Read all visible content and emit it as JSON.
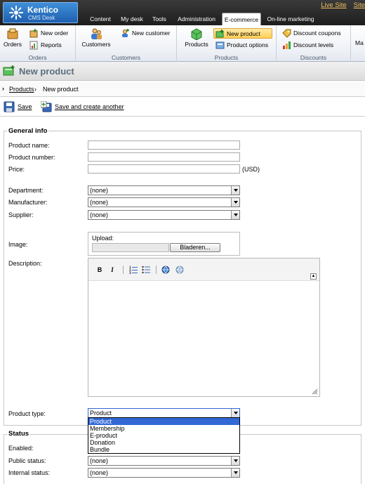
{
  "logo": {
    "brand": "Kentico",
    "sub": "CMS Desk"
  },
  "top_links": [
    "Live Site",
    "Site"
  ],
  "main_tabs": [
    {
      "label": "Content"
    },
    {
      "label": "My desk"
    },
    {
      "label": "Tools"
    },
    {
      "label": "Administration"
    },
    {
      "label": "E-commerce",
      "active": true
    },
    {
      "label": "On-line marketing"
    }
  ],
  "ribbon": {
    "groups": [
      {
        "label": "Orders",
        "items": [
          "Orders",
          "New order",
          "Reports"
        ]
      },
      {
        "label": "Customers",
        "items": [
          "Customers",
          "New customer"
        ]
      },
      {
        "label": "Products",
        "items": [
          "Products",
          "New product",
          "Product options"
        ]
      },
      {
        "label": "Discounts",
        "items": [
          "Discount coupons",
          "Discount levels"
        ]
      },
      {
        "label": "",
        "items": [
          "Ma"
        ]
      }
    ]
  },
  "page": {
    "title": "New product"
  },
  "breadcrumb": {
    "link": "Products",
    "separator": "›",
    "current": "New product"
  },
  "actions": {
    "save": "Save",
    "save_and_create": "Save and create another"
  },
  "general_info": {
    "legend": "General info",
    "product_name_label": "Product name:",
    "product_number_label": "Product number:",
    "price_label": "Price:",
    "currency": "(USD)",
    "department_label": "Department:",
    "department_value": "(none)",
    "manufacturer_label": "Manufacturer:",
    "manufacturer_value": "(none)",
    "supplier_label": "Supplier:",
    "supplier_value": "(none)",
    "image_label": "Image:",
    "upload_label": "Upload:",
    "browse_button": "Bladeren...",
    "description_label": "Description:",
    "editor_buttons": [
      "B",
      "I"
    ],
    "product_type_label": "Product type:",
    "product_type_value": "Product",
    "product_type_options": [
      "Product",
      "Membership",
      "E-product",
      "Donation",
      "Bundle"
    ]
  },
  "status": {
    "legend": "Status",
    "enabled_label": "Enabled:",
    "public_status_label": "Public status:",
    "public_status_value": "(none)",
    "internal_status_label": "Internal status:",
    "internal_status_value": "(none)"
  },
  "colors": {
    "accent": "#3168d5",
    "highlight": "#ffcf55",
    "title": "#5b6e7e"
  }
}
